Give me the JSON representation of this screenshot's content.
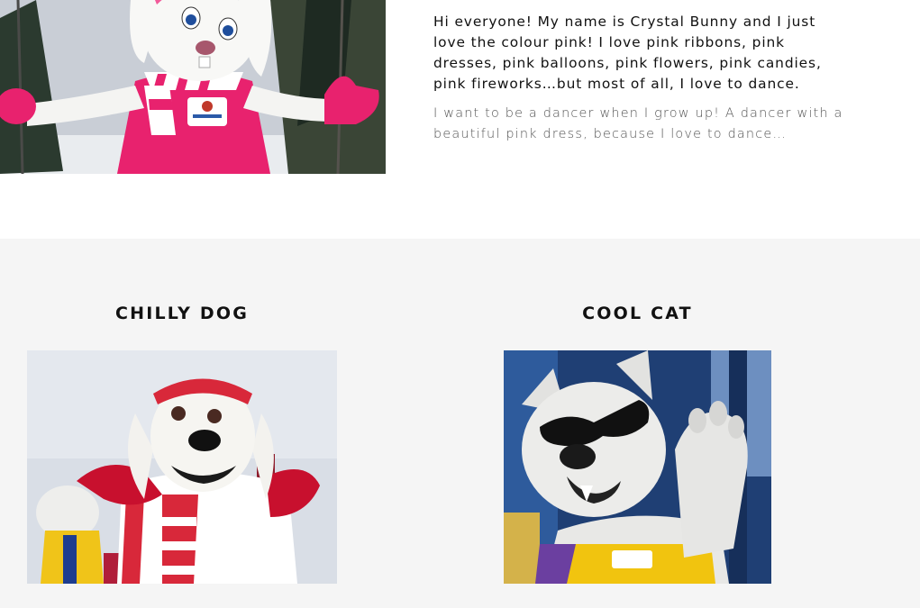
{
  "intro": {
    "main_text": "Hi everyone! My name is Crystal Bunny and I just love the colour pink! I love pink ribbons, pink dresses, pink balloons, pink flowers, pink candies, pink fireworks…but most of all, I love to dance.",
    "secondary_text": "I want to be a dancer when I grow up! A dancer with a beautiful pink dress, because I love to dance…"
  },
  "mascots": [
    {
      "name": "CHILLY DOG"
    },
    {
      "name": "COOL CAT"
    }
  ],
  "colors": {
    "section_background": "#f5f5f5",
    "pink_accent": "#e8226e",
    "red_accent": "#d8283a"
  }
}
